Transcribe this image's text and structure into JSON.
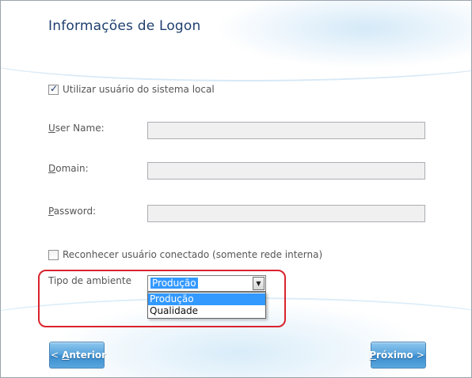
{
  "title": "Informações de Logon",
  "use_local_user": {
    "label": "Utilizar usuário do sistema local",
    "checked": true
  },
  "fields": [
    {
      "label": "User Name:",
      "access_key": "U",
      "rest": "ser Name:",
      "value": ""
    },
    {
      "label": "Domain:",
      "access_key": "D",
      "rest": "omain:",
      "value": ""
    },
    {
      "label": "Password:",
      "access_key": "P",
      "rest": "assword:",
      "value": ""
    }
  ],
  "recognize_user": {
    "label": "Reconhecer usuário conectado (somente rede interna)",
    "checked": false
  },
  "environment": {
    "label": "Tipo de ambiente",
    "selected": "Produção",
    "options": [
      "Produção",
      "Qualidade"
    ]
  },
  "buttons": {
    "back": {
      "chevron": "<",
      "access_key": "A",
      "rest": "nterior"
    },
    "next": {
      "access_key": "P",
      "rest": "róximo",
      "chevron": ">"
    }
  },
  "colors": {
    "title": "#1e3f6e",
    "button": "#5aa5dd",
    "highlight": "#d9232d",
    "selection": "#3399ff"
  }
}
